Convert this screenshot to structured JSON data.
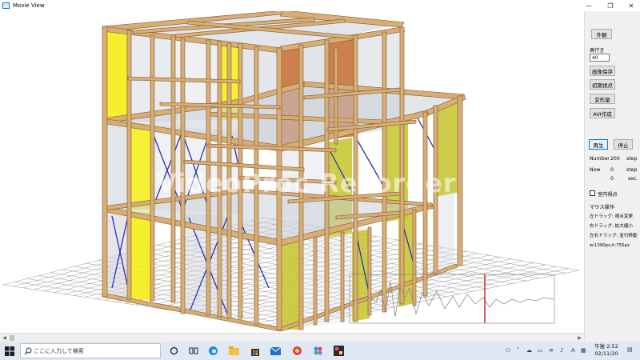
{
  "window": {
    "title": "Movie View",
    "icon": "window-app-icon",
    "controls": {
      "minimize": "—",
      "maximize": "❐",
      "close": "✕"
    }
  },
  "viewport": {
    "watermark": "VideoProc Recorder"
  },
  "panel": {
    "exterior_button": "外観",
    "depth_label": "奥行き",
    "depth_value": "40",
    "save_image_button": "画像保存",
    "reset_view_button": "初期視点",
    "deformation_button": "変形量",
    "avi_button": "AVI作成",
    "play_button": "再生",
    "stop_button": "停止",
    "number_label": "Number",
    "number_value": "200",
    "number_unit": "step",
    "now_label": "Now",
    "now_value": "0",
    "now_unit": "step",
    "sec_value": "0",
    "sec_unit": "sec.",
    "indoor_checkbox_label": "室内視点",
    "mouse_heading": "マウス操作",
    "mouse_left": "左ドラッグ: 視点変更",
    "mouse_right": "右ドラッグ: 拡大縮小",
    "mouse_both": "左右ドラッグ: 並行移動",
    "size_text": "w:1390px,h:755px"
  },
  "taskbar": {
    "search_placeholder": "ここに入力して検索",
    "clock_time": "2:52",
    "clock_ampm": "午後",
    "clock_date": "02/11/20",
    "pinned_icons": [
      "cortana-icon",
      "task-view-icon",
      "edge-icon",
      "file-explorer-icon",
      "store-icon",
      "mail-icon",
      "app-icon-1",
      "app-icon-2",
      "app-icon-3"
    ]
  },
  "colors": {
    "timber": "#d9ad74",
    "timber_edge": "#7a5a2f",
    "yellow_panel": "#f4ee14",
    "olive_panel": "#c9c637",
    "brown_panel": "#c36a2f",
    "brace": "#2b2fb5",
    "grid": "#9a9a9a",
    "wave": "#9a9a9a",
    "time_marker": "#d41414"
  }
}
